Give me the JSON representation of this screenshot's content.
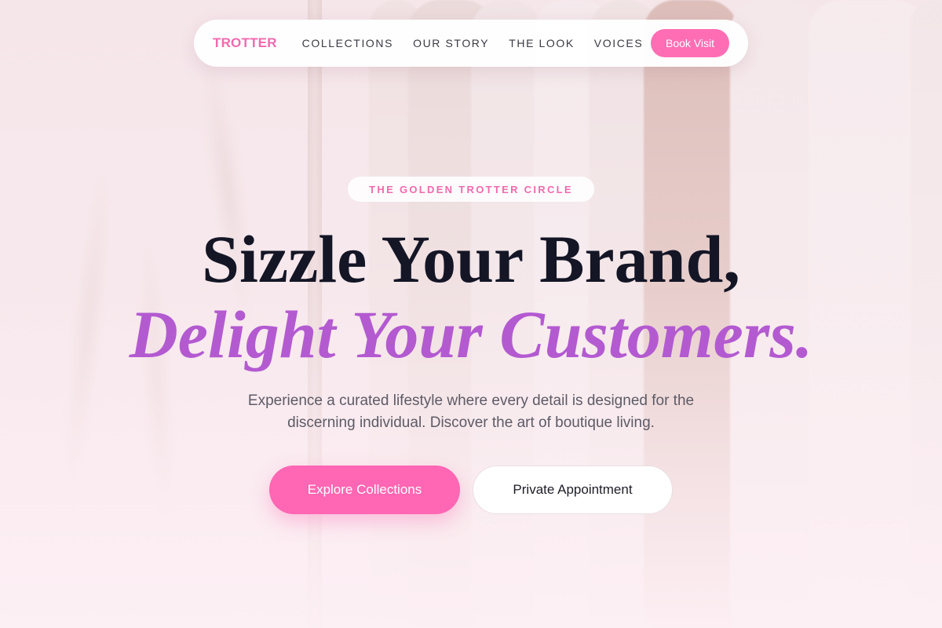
{
  "nav": {
    "brand": "TROTTER",
    "links": [
      "COLLECTIONS",
      "OUR STORY",
      "THE LOOK",
      "VOICES"
    ],
    "cta": "Book Visit"
  },
  "hero": {
    "eyebrow": "THE GOLDEN TROTTER CIRCLE",
    "headline_line1": "Sizzle Your Brand,",
    "headline_line2": "Delight Your Customers.",
    "subtext": "Experience a curated lifestyle where every detail is designed for the discerning individual. Discover the art of boutique living.",
    "primary_cta": "Explore Collections",
    "secondary_cta": "Private Appointment"
  },
  "colors": {
    "brand_pink": "#f06aae",
    "button_pink": "#ff66b3",
    "accent_purple": "#b35ad1",
    "headline_dark": "#141626"
  }
}
